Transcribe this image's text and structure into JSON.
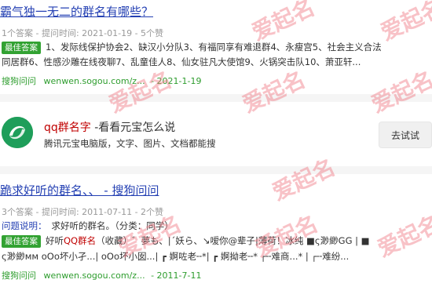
{
  "result1": {
    "title": "霸气独一无二的群名有哪些？",
    "meta": "1个答案 - 提问时间: 2021-01-19 - 5个赞",
    "badge": "最佳答案",
    "line1": "1、发际线保护协会2、缺汉小分队3、有福同享有难退群4、永瘦宫5、社会主义合法",
    "line2": "同居群6、性感沙雕在线夜聊7、乱童佳人8、仙女驻凡大使馆9、火锅突击队10、萧亚轩...",
    "source": "搜狗问问",
    "url": "wenwen.sogou.com/z...",
    "date": "- 2021-1-19"
  },
  "ad": {
    "brand": "qq群名字",
    "title_rest": " -看看元宝怎么说",
    "subtitle": "腾讯元宝电脑版，文字、图片、文档都能搜",
    "button": "去试试"
  },
  "result2": {
    "title": "跪求好听的群名、、 - 搜狗问问",
    "meta": "3个答案 - 提问时间: 2011-07-11 - 2个赞",
    "question_label": "问题说明：",
    "question_text": "求好听的群名。（分类：同学）",
    "badge": "最佳答案",
    "line1_pre": "好听",
    "line1_hl": "QQ群名",
    "line1_post": "（收藏）゛夢も、|ˊ妖ら、↘嗳你@辈子|薄荷！冰纯 ■ς渺緲GG | ■",
    "line2": "ς渺緲ᴍᴍ oOo坏小孑...| oOo坏小囡...| ┏ 婀咗老╌*| ┏ 婀拗老╌*  ┌╌难商...* | ┌╌难纷...",
    "source": "搜狗问问",
    "url": "wenwen.sogou.com/z...",
    "date": "- 2011-7-11"
  },
  "watermark": "爱起名",
  "colors": {
    "link": "#2440b3",
    "url": "#2e9d2e",
    "badge": "#32a232",
    "highlight": "#c00000",
    "watermark": "#f07882"
  }
}
